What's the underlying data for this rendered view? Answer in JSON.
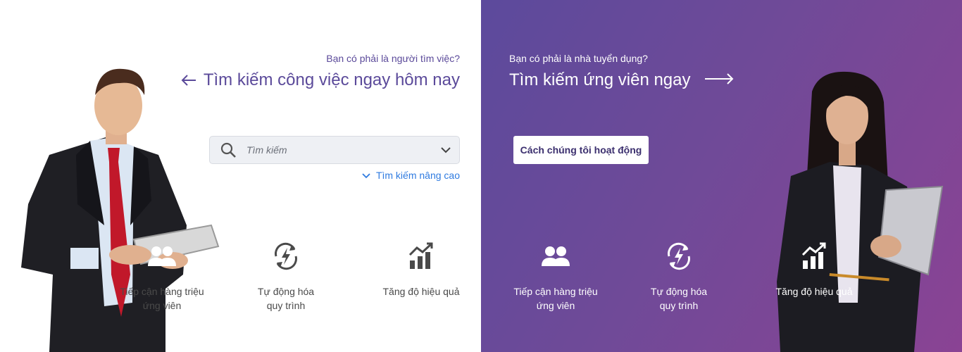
{
  "left": {
    "question": "Bạn có phải là người tìm việc?",
    "headline": "Tìm kiếm công việc ngay hôm nay",
    "search": {
      "placeholder": "Tìm kiếm"
    },
    "advanced_link": "Tìm kiếm nâng cao",
    "features": [
      {
        "icon": "users-icon",
        "line1": "Tiếp cận hàng triệu",
        "line2": "ứng viên"
      },
      {
        "icon": "lightning-refresh-icon",
        "line1": "Tự động hóa",
        "line2": "quy trình"
      },
      {
        "icon": "growth-chart-icon",
        "line1": "Tăng độ hiệu quả",
        "line2": ""
      }
    ]
  },
  "right": {
    "question": "Bạn có phải là nhà tuyển dụng?",
    "headline": "Tìm kiếm ứng viên ngay",
    "button_label": "Cách chúng tôi hoạt động",
    "features": [
      {
        "icon": "users-icon",
        "line1": "Tiếp cận hàng triệu",
        "line2": "ứng viên"
      },
      {
        "icon": "lightning-refresh-icon",
        "line1": "Tự động hóa",
        "line2": "quy trình"
      },
      {
        "icon": "growth-chart-icon",
        "line1": "Tăng độ hiệu quả",
        "line2": ""
      }
    ]
  },
  "colors": {
    "left_text": "#5b4a9a",
    "link": "#2f7be0",
    "gradient_start": "#5c4a9c",
    "gradient_end": "#8a4394"
  }
}
